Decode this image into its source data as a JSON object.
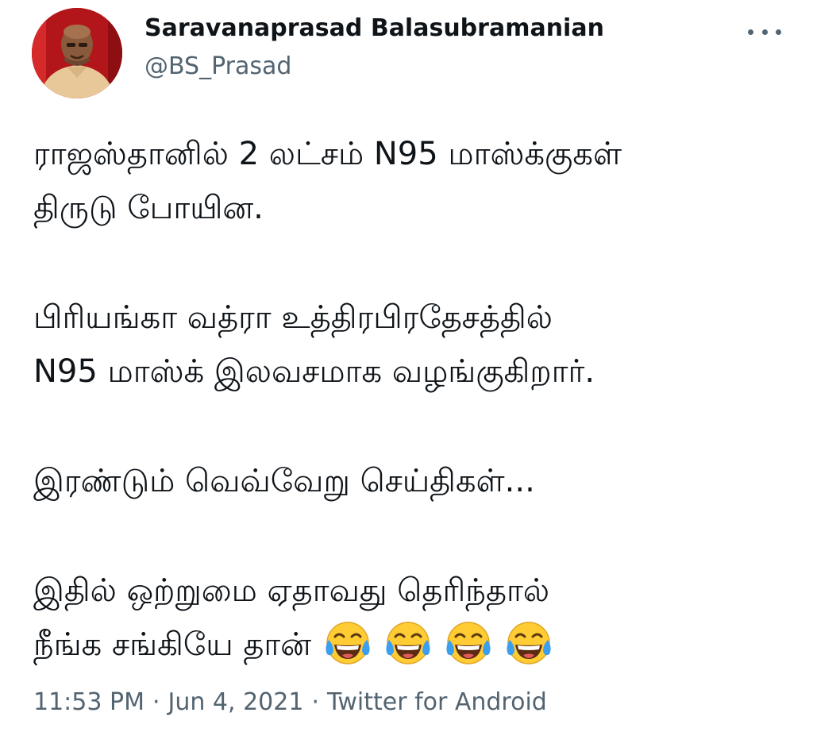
{
  "author": {
    "display_name": "Saravanaprasad Balasubramanian",
    "handle": "@BS_Prasad",
    "avatar_icon": "profile-photo-avatar"
  },
  "more_icon": "more-horizontal-icon",
  "tweet": {
    "paragraphs": [
      {
        "lines": [
          "ராஜஸ்தானில் 2 லட்சம் N95 மாஸ்க்குகள்",
          "திருடு போயின."
        ]
      },
      {
        "lines": [
          "பிரியங்கா வத்ரா உத்திரபிரதேசத்தில்",
          "N95 மாஸ்க் இலவசமாக வழங்குகிறார்."
        ]
      },
      {
        "lines": [
          "இரண்டும் வெவ்வேறு செய்திகள்..."
        ]
      },
      {
        "lines": [
          "இதில் ஒற்றுமை ஏதாவது தெரிந்தால்",
          "நீங்க சங்கியே தான்"
        ]
      }
    ],
    "emoji": [
      "face-with-tears-of-joy-icon",
      "face-with-tears-of-joy-icon",
      "face-with-tears-of-joy-icon",
      "face-with-tears-of-joy-icon"
    ]
  },
  "meta": {
    "time": "11:53 PM",
    "date": "Jun 4, 2021",
    "source": "Twitter for Android",
    "separator": "·"
  },
  "colors": {
    "text_primary": "#0f1419",
    "text_secondary": "#536471",
    "avatar_background": "#c81c1c",
    "emoji_face": "#ffcc33",
    "emoji_tears": "#3b9ff0"
  }
}
